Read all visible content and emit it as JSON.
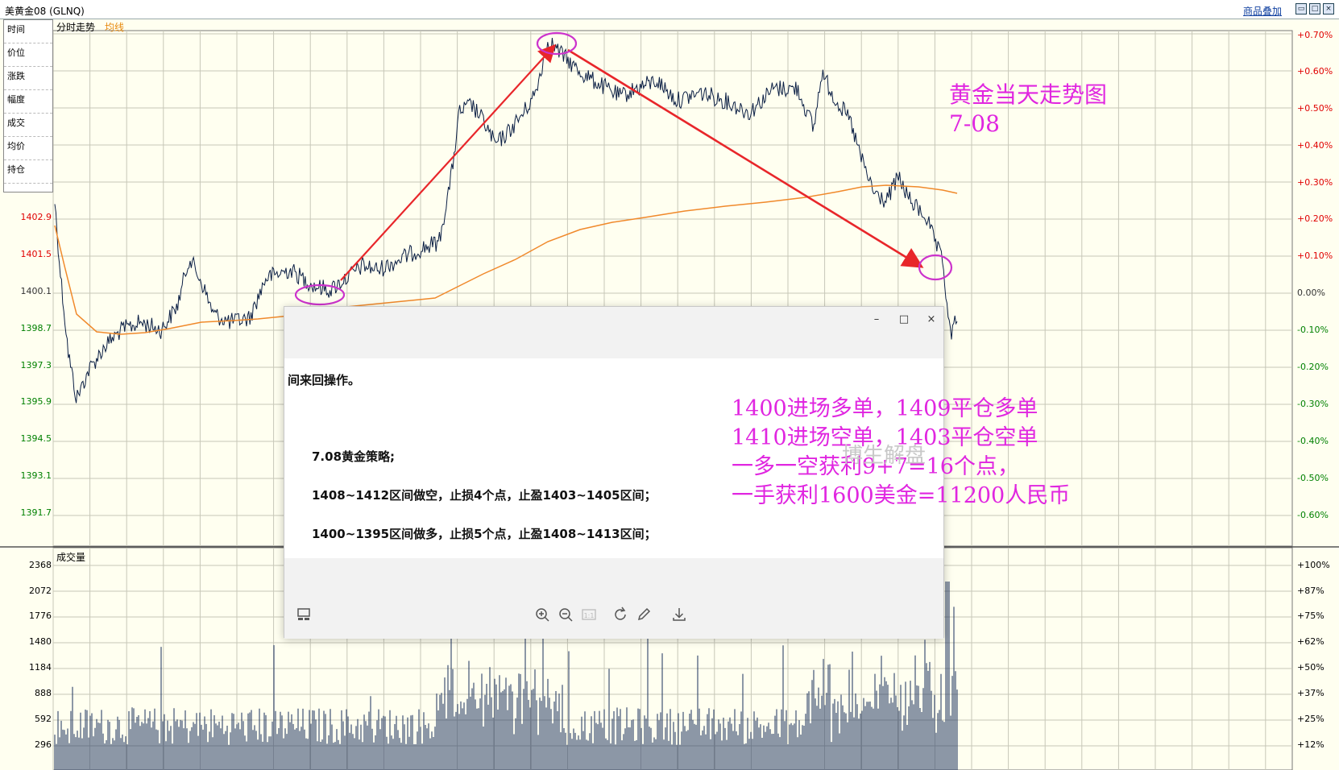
{
  "window": {
    "title": "美黄金08 (GLNQ)",
    "add_product_label": "商品叠加",
    "window_controls": [
      "restore-icon",
      "maximize-icon",
      "close-icon"
    ]
  },
  "info_panel": {
    "rows": [
      "时间",
      "价位",
      "涨跌",
      "幅度",
      "成交",
      "均价",
      "持仓"
    ]
  },
  "price_chart": {
    "mode_label": "分时走势",
    "avg_label": "均线",
    "y_labels": [
      "1402.9",
      "1401.5",
      "1400.1",
      "1398.7",
      "1397.3",
      "1395.9",
      "1394.5",
      "1393.1",
      "1391.7"
    ],
    "right_labels": [
      "+0.70%",
      "+0.60%",
      "+0.50%",
      "+0.40%",
      "+0.30%",
      "+0.20%",
      "+0.10%",
      "0.00%",
      "-0.10%",
      "-0.20%",
      "-0.30%",
      "-0.40%",
      "-0.50%",
      "-0.60%"
    ]
  },
  "volume_chart": {
    "label": "成交量",
    "y_labels": [
      "2368",
      "2072",
      "1776",
      "1480",
      "1184",
      "888",
      "592",
      "296"
    ],
    "right_labels": [
      "+100%",
      "+87%",
      "+75%",
      "+62%",
      "+50%",
      "+37%",
      "+25%",
      "+12%"
    ]
  },
  "colors": {
    "background": "#fffff0",
    "grid": "#c7c7b8",
    "price_line": "#0a1e44",
    "avg_line": "#f0892b",
    "arrow": "#e8262a",
    "annotation": "#e026e0",
    "positive": "#e00000",
    "negative": "#008000"
  },
  "annotations": {
    "title_line1": "黄金当天走势图",
    "title_line2": "7-08",
    "result_lines": [
      "1400进场多单，1409平仓多单",
      "1410进场空单，1403平仓空单",
      "一多一空获利9+7=16个点，",
      "一手获利1600美金=11200人民币"
    ]
  },
  "dialog": {
    "controls": [
      "minimize-icon",
      "maximize-icon",
      "close-icon"
    ],
    "partial_line": "间来回操作。",
    "strategy_title": "7.08黄金策略;",
    "strategy_short": "1408~1412区间做空，止损4个点，止盈1403~1405区间；",
    "strategy_long": "1400~1395区间做多，止损5个点，止盈1408~1413区间；",
    "watermark": "博生解盘",
    "toolbar": [
      "gallery-icon",
      "zoom-in-icon",
      "zoom-out-icon",
      "actual-size-icon",
      "rotate-icon",
      "edit-icon",
      "download-icon"
    ]
  }
}
